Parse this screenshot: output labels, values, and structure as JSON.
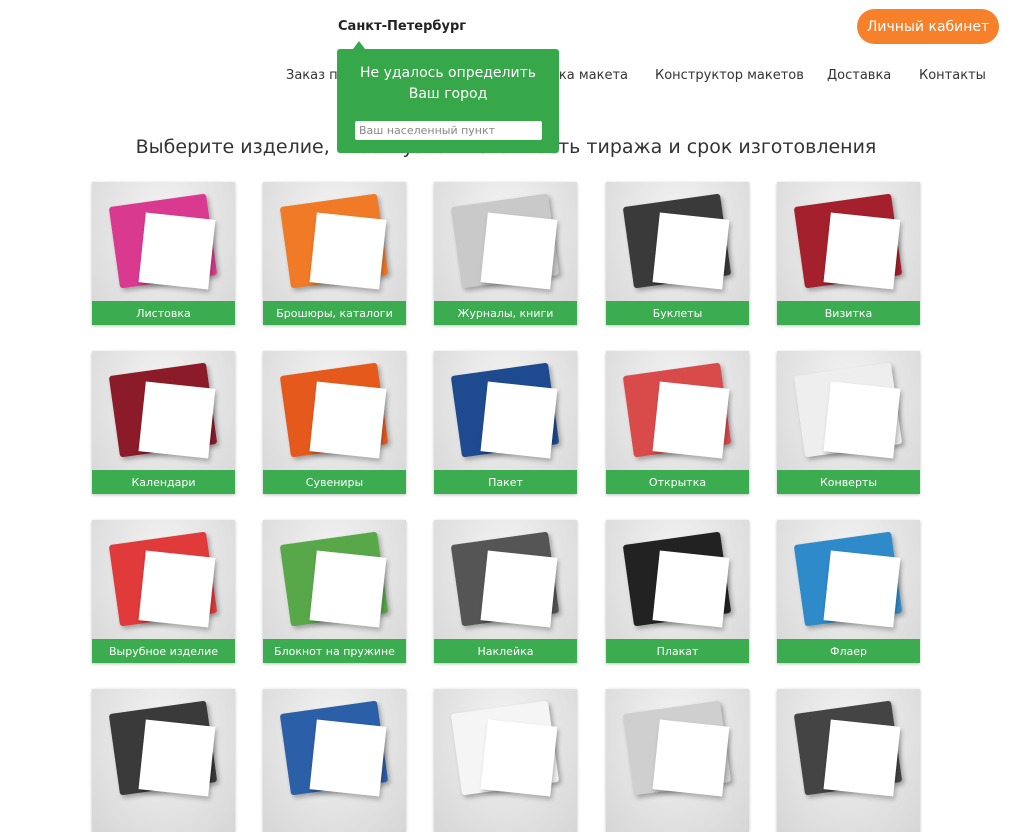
{
  "header": {
    "city": "Санкт-Петербург",
    "cabinet_label": "Личный кабинет"
  },
  "nav": {
    "items": [
      "Заказ по телефону",
      "Проверка макета",
      "Конструктор макетов",
      "Доставка",
      "Контакты"
    ]
  },
  "popup": {
    "message_line1": "Не удалось определить",
    "message_line2": "Ваш город",
    "input_placeholder": "Ваш населенный пункт"
  },
  "page_title": "Выберите изделие, чтобы узнать стоимость тиража и срок изготовления",
  "products": [
    {
      "label": "Листовка",
      "color": "#d93a8f"
    },
    {
      "label": "Брошюры, каталоги",
      "color": "#f07a26"
    },
    {
      "label": "Журналы, книги",
      "color": "#c9c9c9"
    },
    {
      "label": "Буклеты",
      "color": "#3a3a3a"
    },
    {
      "label": "Визитка",
      "color": "#a3202c"
    },
    {
      "label": "Календари",
      "color": "#8c1b2a"
    },
    {
      "label": "Сувениры",
      "color": "#e55a1c"
    },
    {
      "label": "Пакет",
      "color": "#1e4a8f"
    },
    {
      "label": "Открытка",
      "color": "#d94b4b"
    },
    {
      "label": "Конверты",
      "color": "#eeeeee"
    },
    {
      "label": "Вырубное изделие",
      "color": "#e03a3a"
    },
    {
      "label": "Блокнот на пружине",
      "color": "#58a84a"
    },
    {
      "label": "Наклейка",
      "color": "#555555"
    },
    {
      "label": "Плакат",
      "color": "#222222"
    },
    {
      "label": "Флаер",
      "color": "#2f8ac9"
    },
    {
      "label": "",
      "color": "#3a3a3a"
    },
    {
      "label": "",
      "color": "#2b5fa8"
    },
    {
      "label": "",
      "color": "#f5f5f5"
    },
    {
      "label": "",
      "color": "#cfcfcf"
    },
    {
      "label": "",
      "color": "#444444"
    }
  ]
}
